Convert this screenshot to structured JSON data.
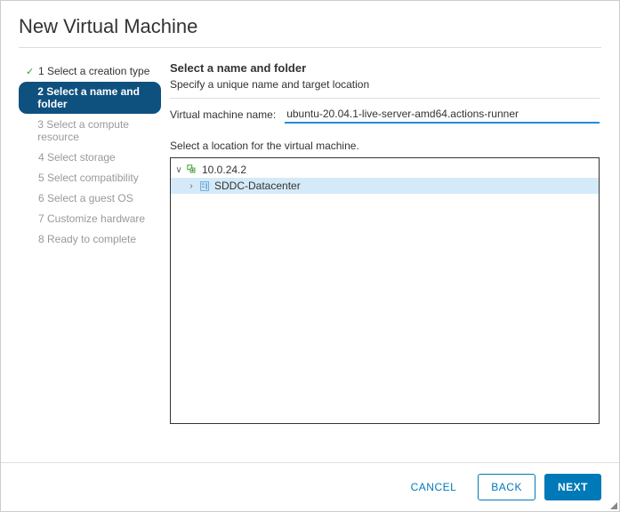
{
  "title": "New Virtual Machine",
  "steps": [
    {
      "label": "1 Select a creation type",
      "state": "done"
    },
    {
      "label": "2 Select a name and folder",
      "state": "active"
    },
    {
      "label": "3 Select a compute resource",
      "state": "pending"
    },
    {
      "label": "4 Select storage",
      "state": "pending"
    },
    {
      "label": "5 Select compatibility",
      "state": "pending"
    },
    {
      "label": "6 Select a guest OS",
      "state": "pending"
    },
    {
      "label": "7 Customize hardware",
      "state": "pending"
    },
    {
      "label": "8 Ready to complete",
      "state": "pending"
    }
  ],
  "main": {
    "heading": "Select a name and folder",
    "subheading": "Specify a unique name and target location",
    "name_label": "Virtual machine name:",
    "name_value": "ubuntu-20.04.1-live-server-amd64.actions-runner",
    "location_label": "Select a location for the virtual machine.",
    "tree": {
      "root": {
        "label": "10.0.24.2",
        "expanded": true
      },
      "child": {
        "label": "SDDC-Datacenter",
        "expanded": false,
        "selected": true
      }
    }
  },
  "footer": {
    "cancel": "CANCEL",
    "back": "BACK",
    "next": "NEXT"
  }
}
